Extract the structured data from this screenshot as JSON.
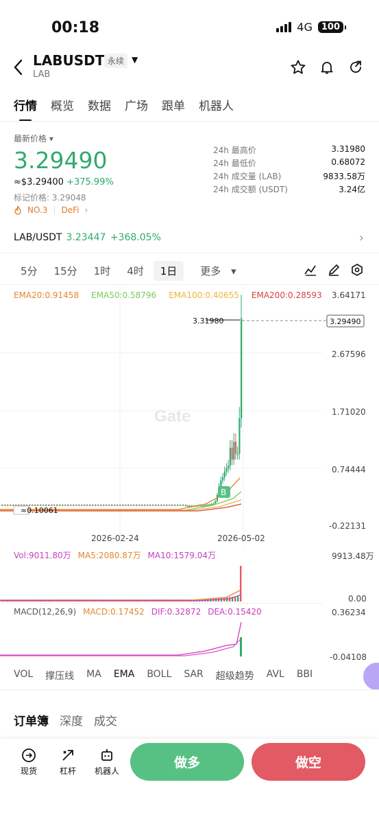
{
  "status": {
    "time": "00:18",
    "network": "4G",
    "battery": "100"
  },
  "header": {
    "pair": "LABUSDT",
    "contract": "永续",
    "base": "LAB"
  },
  "tabs": [
    "行情",
    "概览",
    "数据",
    "广场",
    "跟单",
    "机器人"
  ],
  "price": {
    "label": "最新价格",
    "last": "3.29490",
    "approx": "≈$3.29400",
    "change": "+375.99%",
    "mark": "标记价格: 3.29048",
    "rank": "NO.3",
    "sector": "DeFi"
  },
  "stats": [
    {
      "k": "24h 最高价",
      "v": "3.31980"
    },
    {
      "k": "24h 最低价",
      "v": "0.68072"
    },
    {
      "k": "24h 成交量 (LAB)",
      "v": "9833.58万"
    },
    {
      "k": "24h 成交额 (USDT)",
      "v": "3.24亿"
    }
  ],
  "spot": {
    "pair": "LAB/USDT",
    "price": "3.23447",
    "change": "+368.05%"
  },
  "timeframes": [
    "5分",
    "15分",
    "1时",
    "4时",
    "1日",
    "更多"
  ],
  "ema": {
    "ema20": "EMA20:0.91458",
    "ema50": "EMA50:0.58796",
    "ema100": "EMA100:0.40655",
    "ema200": "EMA200:0.28593"
  },
  "colors": {
    "green": "#2faa6d",
    "red": "#e25a64",
    "ema20": "#e5862e",
    "ema50": "#7cc85b",
    "ema100": "#f0b43c",
    "ema200": "#d94040",
    "macd": "#c83dbd"
  },
  "chart_data": {
    "type": "candlestick",
    "ytick_labels": [
      "3.64171",
      "2.67596",
      "1.71020",
      "0.74444",
      "-0.22131"
    ],
    "x_tick_labels": [
      "2026-02-24",
      "2026-05-02"
    ],
    "high_label": "3.31980",
    "low_label": "0.10061",
    "current_label": "3.29490",
    "watermark": "Gate",
    "marker": "B",
    "approx_closes": [
      0.12,
      0.12,
      0.12,
      0.11,
      0.12,
      0.12,
      0.12,
      0.13,
      0.12,
      0.12,
      0.13,
      0.13,
      0.14,
      0.14,
      0.15,
      0.16,
      0.2,
      0.3,
      0.45,
      0.55,
      0.6,
      0.7,
      0.75,
      0.8,
      1.1,
      0.9,
      1.2,
      1.0,
      1.0,
      1.6,
      3.29
    ]
  },
  "volume": {
    "vol": "Vol:9011.80万",
    "ma5": "MA5:2080.87万",
    "ma10": "MA10:1579.04万",
    "max": "9913.48万",
    "min": "0.00"
  },
  "macd": {
    "title": "MACD(12,26,9)",
    "macd": "MACD:0.17452",
    "dif": "DIF:0.32872",
    "dea": "DEA:0.15420",
    "max": "0.36234",
    "min": "-0.04108"
  },
  "indicators": [
    "VOL",
    "撑压线",
    "MA",
    "EMA",
    "BOLL",
    "SAR",
    "超级趋势",
    "AVL",
    "BBI"
  ],
  "orderbook_tabs": [
    "订单簿",
    "深度",
    "成交"
  ],
  "bottom": {
    "spot": "现货",
    "leverage": "杠杆",
    "bot": "机器人",
    "long": "做多",
    "short": "做空"
  }
}
